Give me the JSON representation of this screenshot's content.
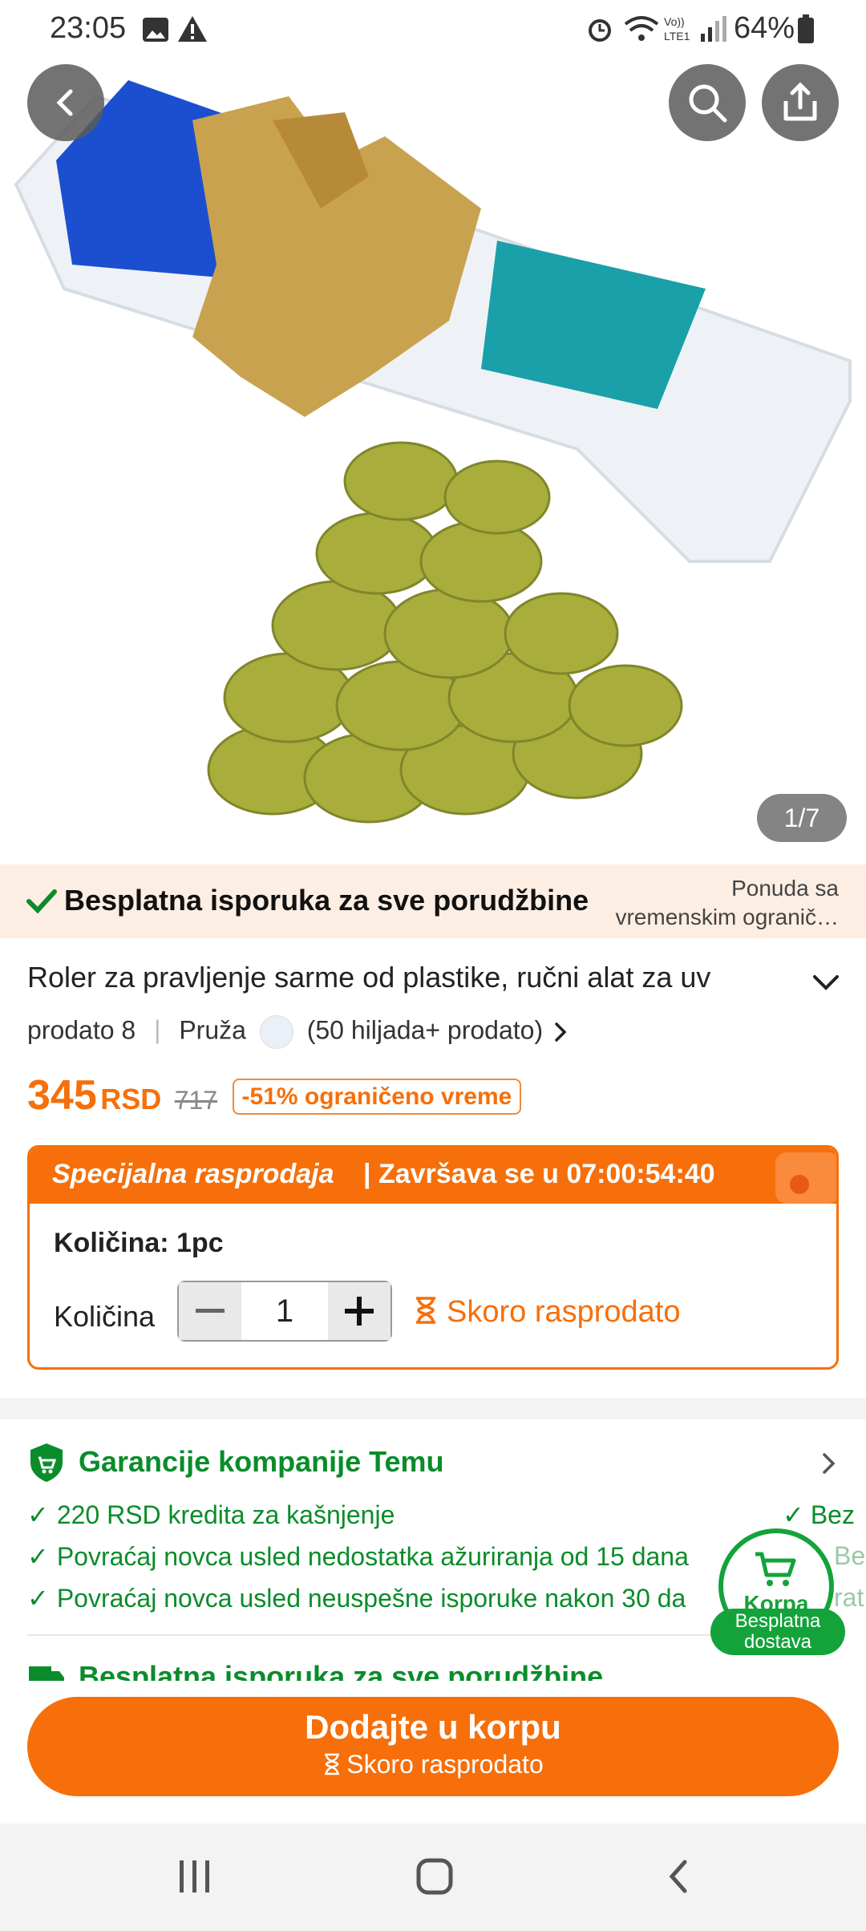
{
  "status_bar": {
    "time": "23:05",
    "battery": "64%"
  },
  "gallery": {
    "counter": "1/7"
  },
  "shipping_banner": {
    "text": "Besplatna isporuka za sve porudžbine",
    "offer_line1": "Ponuda sa",
    "offer_line2": "vremenskim ogranič…"
  },
  "product": {
    "title": "Roler za pravljenje sarme od plastike, ručni alat za uv",
    "sold": "prodato 8",
    "provider_label": "Pruža",
    "provider_sold": "(50 hiljada+ prodato)"
  },
  "price": {
    "current": "345",
    "currency": "RSD",
    "original": "717",
    "discount": "-51% ograničeno vreme"
  },
  "flash_sale": {
    "title": "Specijalna rasprodaja",
    "ends": "| Završava se u  07:00:54:40",
    "quantity_option": "Količina: 1pc",
    "quantity_label": "Količina",
    "quantity_value": "1",
    "stock_status": "Skoro rasprodato"
  },
  "guarantees": {
    "title": "Garancije kompanije Temu",
    "items": [
      "220 RSD kredita za kašnjenje",
      "Povraćaj novca usled nedostatka ažuriranja od 15 dana",
      "Povraćaj novca usled neuspešne isporuke nakon 30 da"
    ],
    "right_items": [
      "Bez",
      "Bes",
      "rat"
    ]
  },
  "shipping_section": {
    "title": "Besplatna isporuka za sve porudžbine"
  },
  "cart": {
    "label": "Korpa",
    "badge_line1": "Besplatna",
    "badge_line2": "dostava"
  },
  "add_to_cart": {
    "label": "Dodajte u korpu",
    "sub": "Skoro rasprodato"
  },
  "colors": {
    "accent": "#f66f0a",
    "green": "#0a8c2a"
  }
}
